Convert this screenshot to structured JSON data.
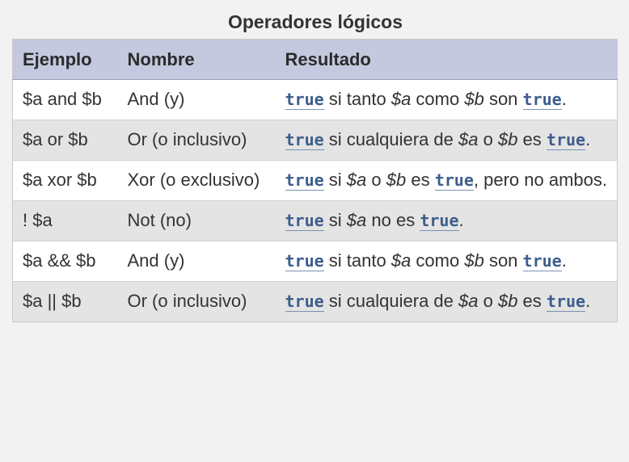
{
  "caption": "Operadores lógicos",
  "headers": [
    "Ejemplo",
    "Nombre",
    "Resultado"
  ],
  "rows": [
    {
      "example": "$a and $b",
      "name": "And (y)",
      "result": [
        {
          "type": "kw",
          "text": "true"
        },
        {
          "type": "text",
          "text": " si tanto "
        },
        {
          "type": "var",
          "text": "$a"
        },
        {
          "type": "text",
          "text": " como "
        },
        {
          "type": "var",
          "text": "$b"
        },
        {
          "type": "text",
          "text": " son "
        },
        {
          "type": "kw",
          "text": "true"
        },
        {
          "type": "text",
          "text": "."
        }
      ]
    },
    {
      "example": "$a or $b",
      "name": "Or (o inclusivo)",
      "result": [
        {
          "type": "kw",
          "text": "true"
        },
        {
          "type": "text",
          "text": " si cualquiera de "
        },
        {
          "type": "var",
          "text": "$a"
        },
        {
          "type": "text",
          "text": " o "
        },
        {
          "type": "var",
          "text": "$b"
        },
        {
          "type": "text",
          "text": " es "
        },
        {
          "type": "kw",
          "text": "true"
        },
        {
          "type": "text",
          "text": "."
        }
      ]
    },
    {
      "example": "$a xor $b",
      "name": "Xor (o exclusivo)",
      "result": [
        {
          "type": "kw",
          "text": "true"
        },
        {
          "type": "text",
          "text": " si "
        },
        {
          "type": "var",
          "text": "$a"
        },
        {
          "type": "text",
          "text": " o "
        },
        {
          "type": "var",
          "text": "$b"
        },
        {
          "type": "text",
          "text": " es "
        },
        {
          "type": "kw",
          "text": "true"
        },
        {
          "type": "text",
          "text": ", pero no ambos."
        }
      ]
    },
    {
      "example": "! $a",
      "name": "Not (no)",
      "result": [
        {
          "type": "kw",
          "text": "true"
        },
        {
          "type": "text",
          "text": " si "
        },
        {
          "type": "var",
          "text": "$a"
        },
        {
          "type": "text",
          "text": " no es "
        },
        {
          "type": "kw",
          "text": "true"
        },
        {
          "type": "text",
          "text": "."
        }
      ]
    },
    {
      "example": "$a && $b",
      "name": "And (y)",
      "result": [
        {
          "type": "kw",
          "text": "true"
        },
        {
          "type": "text",
          "text": " si tanto "
        },
        {
          "type": "var",
          "text": "$a"
        },
        {
          "type": "text",
          "text": " como "
        },
        {
          "type": "var",
          "text": "$b"
        },
        {
          "type": "text",
          "text": " son "
        },
        {
          "type": "kw",
          "text": "true"
        },
        {
          "type": "text",
          "text": "."
        }
      ]
    },
    {
      "example": "$a || $b",
      "name": "Or (o inclusivo)",
      "result": [
        {
          "type": "kw",
          "text": "true"
        },
        {
          "type": "text",
          "text": " si cualquiera de "
        },
        {
          "type": "var",
          "text": "$a"
        },
        {
          "type": "text",
          "text": " o "
        },
        {
          "type": "var",
          "text": "$b"
        },
        {
          "type": "text",
          "text": " es "
        },
        {
          "type": "kw",
          "text": "true"
        },
        {
          "type": "text",
          "text": "."
        }
      ]
    }
  ]
}
